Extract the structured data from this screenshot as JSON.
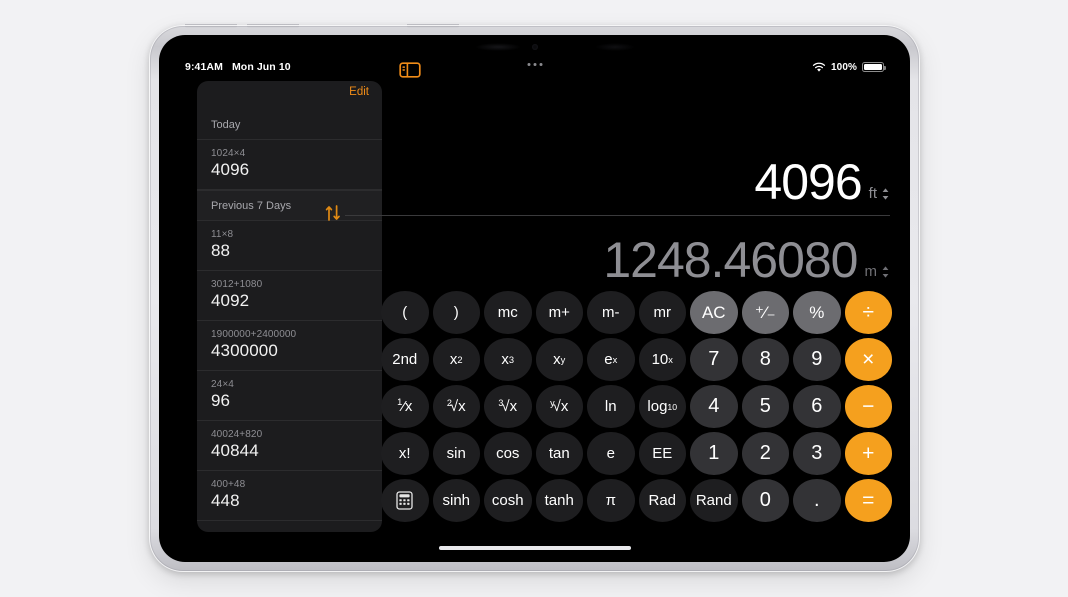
{
  "statusbar": {
    "time": "9:41AM",
    "date": "Mon Jun 10",
    "battery_percent": "100%",
    "wifi_icon": "wifi-icon",
    "battery_icon": "battery-icon"
  },
  "history": {
    "edit_label": "Edit",
    "sections": [
      {
        "title": "Today",
        "entries": [
          {
            "expression": "1024×4",
            "result": "4096"
          }
        ]
      },
      {
        "title": "Previous 7 Days",
        "entries": [
          {
            "expression": "11×8",
            "result": "88"
          },
          {
            "expression": "3012+1080",
            "result": "4092"
          },
          {
            "expression": "1900000+2400000",
            "result": "4300000"
          },
          {
            "expression": "24×4",
            "result": "96"
          },
          {
            "expression": "40024+820",
            "result": "40844"
          },
          {
            "expression": "400+48",
            "result": "448"
          }
        ]
      }
    ]
  },
  "toolbar": {
    "sidebar_toggle_icon": "sidebar-toggle-icon"
  },
  "display": {
    "input_value": "4096",
    "input_unit": "ft",
    "output_value": "1248.46080",
    "output_unit": "m",
    "swap_icon": "swap-vertical-icon",
    "unit_chevron_icon": "chevron-up-down-icon"
  },
  "keypad": {
    "rows": [
      [
        {
          "label": "(",
          "type": "fn",
          "name": "key-open-paren"
        },
        {
          "label": ")",
          "type": "fn",
          "name": "key-close-paren"
        },
        {
          "label": "mc",
          "type": "fn",
          "name": "key-memory-clear"
        },
        {
          "label": "m+",
          "type": "fn",
          "name": "key-memory-add"
        },
        {
          "label": "m-",
          "type": "fn",
          "name": "key-memory-subtract"
        },
        {
          "label": "mr",
          "type": "fn",
          "name": "key-memory-recall"
        },
        {
          "label": "AC",
          "type": "util",
          "name": "key-all-clear"
        },
        {
          "label": "⁺⁄₋",
          "type": "util",
          "name": "key-plus-minus"
        },
        {
          "label": "%",
          "type": "util",
          "name": "key-percent"
        },
        {
          "label": "÷",
          "type": "op",
          "name": "key-divide"
        }
      ],
      [
        {
          "label": "2nd",
          "type": "fn",
          "name": "key-second"
        },
        {
          "label": "x2",
          "type": "fn",
          "name": "key-x-squared",
          "sup": "2",
          "base": "x"
        },
        {
          "label": "x3",
          "type": "fn",
          "name": "key-x-cubed",
          "sup": "3",
          "base": "x"
        },
        {
          "label": "xy",
          "type": "fn",
          "name": "key-x-power-y",
          "sup": "y",
          "base": "x"
        },
        {
          "label": "ex",
          "type": "fn",
          "name": "key-e-power-x",
          "sup": "x",
          "base": "e"
        },
        {
          "label": "10x",
          "type": "fn",
          "name": "key-ten-power-x",
          "sup": "x",
          "base": "10"
        },
        {
          "label": "7",
          "type": "num",
          "name": "key-7"
        },
        {
          "label": "8",
          "type": "num",
          "name": "key-8"
        },
        {
          "label": "9",
          "type": "num",
          "name": "key-9"
        },
        {
          "label": "×",
          "type": "op",
          "name": "key-multiply"
        }
      ],
      [
        {
          "label": "⁄x",
          "type": "fn",
          "name": "key-reciprocal",
          "frac": "1"
        },
        {
          "label": "√x",
          "type": "fn",
          "name": "key-square-root",
          "index": "2"
        },
        {
          "label": "√x",
          "type": "fn",
          "name": "key-cube-root",
          "index": "3"
        },
        {
          "label": "√x",
          "type": "fn",
          "name": "key-y-root",
          "index": "y"
        },
        {
          "label": "ln",
          "type": "fn",
          "name": "key-natural-log"
        },
        {
          "label": "log10",
          "type": "fn",
          "name": "key-log-base-10",
          "base": "log",
          "sub": "10"
        },
        {
          "label": "4",
          "type": "num",
          "name": "key-4"
        },
        {
          "label": "5",
          "type": "num",
          "name": "key-5"
        },
        {
          "label": "6",
          "type": "num",
          "name": "key-6"
        },
        {
          "label": "−",
          "type": "op",
          "name": "key-subtract"
        }
      ],
      [
        {
          "label": "x!",
          "type": "fn",
          "name": "key-factorial"
        },
        {
          "label": "sin",
          "type": "fn",
          "name": "key-sin"
        },
        {
          "label": "cos",
          "type": "fn",
          "name": "key-cos"
        },
        {
          "label": "tan",
          "type": "fn",
          "name": "key-tan"
        },
        {
          "label": "e",
          "type": "fn",
          "name": "key-euler"
        },
        {
          "label": "EE",
          "type": "fn",
          "name": "key-exponent"
        },
        {
          "label": "1",
          "type": "num",
          "name": "key-1"
        },
        {
          "label": "2",
          "type": "num",
          "name": "key-2"
        },
        {
          "label": "3",
          "type": "num",
          "name": "key-3"
        },
        {
          "label": "+",
          "type": "op",
          "name": "key-add"
        }
      ],
      [
        {
          "label": "",
          "type": "fn",
          "name": "key-calculator-mode",
          "icon": "calculator-icon"
        },
        {
          "label": "sinh",
          "type": "fn",
          "name": "key-sinh"
        },
        {
          "label": "cosh",
          "type": "fn",
          "name": "key-cosh"
        },
        {
          "label": "tanh",
          "type": "fn",
          "name": "key-tanh"
        },
        {
          "label": "π",
          "type": "fn",
          "name": "key-pi"
        },
        {
          "label": "Rad",
          "type": "fn",
          "name": "key-radians"
        },
        {
          "label": "Rand",
          "type": "fn",
          "name": "key-random"
        },
        {
          "label": "0",
          "type": "num",
          "name": "key-0"
        },
        {
          "label": ".",
          "type": "num",
          "name": "key-decimal"
        },
        {
          "label": "=",
          "type": "op",
          "name": "key-equals"
        }
      ]
    ]
  },
  "colors": {
    "accent_orange": "#f5a01e",
    "edit_orange": "#f08c18",
    "key_function": "#1e1e20",
    "key_number": "#333336",
    "key_utility": "#6c6c70",
    "screen_background": "#000000",
    "sidebar_background": "#1c1c1e",
    "page_background": "#f2f2f4"
  }
}
